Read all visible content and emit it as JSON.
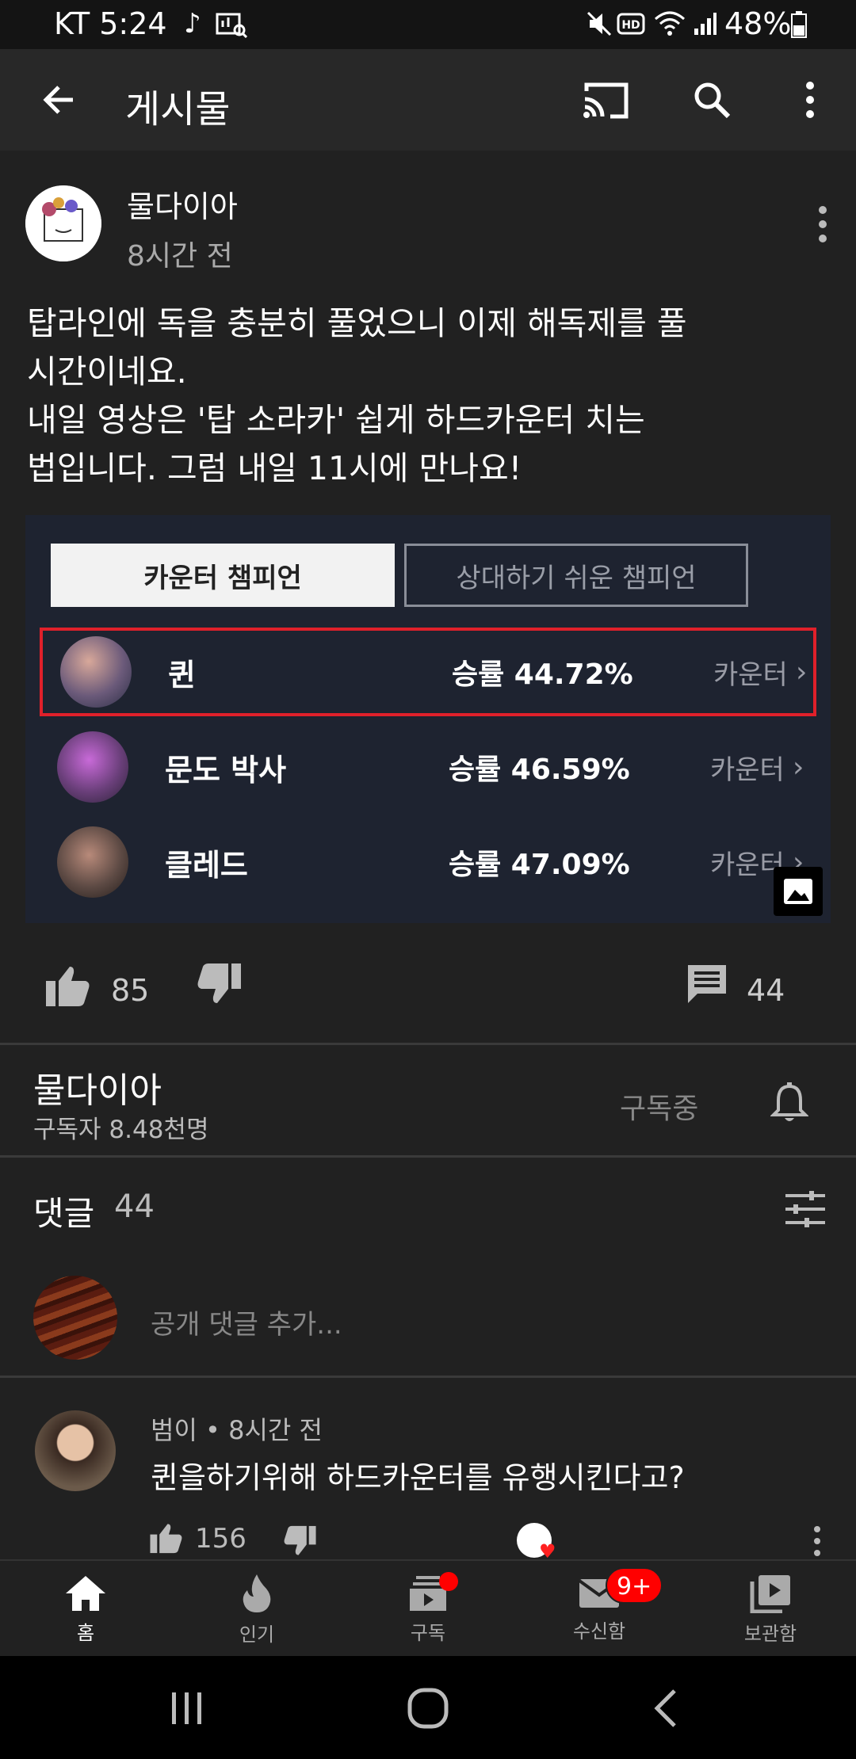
{
  "status": {
    "carrier_time": "KT 5:24",
    "battery": "48%"
  },
  "appbar": {
    "title": "게시물"
  },
  "post": {
    "author": "물다이아",
    "time": "8시간 전",
    "text": "탑라인에 독을 충분히 풀었으니 이제 해독제를 풀\n시간이네요.\n내일 영상은 '탑 소라카' 쉽게 하드카운터 치는\n법입니다. 그럼 내일 11시에 만나요!",
    "image": {
      "tab_active": "카운터 챔피언",
      "tab_inactive": "상대하기 쉬운 챔피언",
      "rows": [
        {
          "name": "퀸",
          "winrate": "승률 44.72%",
          "link": "카운터",
          "highlighted": true,
          "color": "#6b5a7a"
        },
        {
          "name": "문도 박사",
          "winrate": "승률 46.59%",
          "link": "카운터",
          "highlighted": false,
          "color": "#6a3f7a"
        },
        {
          "name": "클레드",
          "winrate": "승률 47.09%",
          "link": "카운터",
          "highlighted": false,
          "color": "#5d4a44"
        }
      ]
    },
    "likes": "85",
    "comments": "44"
  },
  "channel": {
    "name": "물다이아",
    "subscribers": "구독자 8.48천명",
    "subscribed_label": "구독중"
  },
  "comments_section": {
    "title": "댓글",
    "count": "44",
    "placeholder": "공개 댓글 추가...",
    "first_comment": {
      "author_meta": "범이 • 8시간 전",
      "text": "퀸을하기위해 하드카운터를 유행시킨다고?",
      "likes": "156"
    }
  },
  "bottom_nav": {
    "items": [
      {
        "label": "홈",
        "icon": "home-icon"
      },
      {
        "label": "인기",
        "icon": "fire-icon"
      },
      {
        "label": "구독",
        "icon": "subscriptions-icon"
      },
      {
        "label": "수신함",
        "icon": "inbox-icon"
      },
      {
        "label": "보관함",
        "icon": "library-icon"
      }
    ],
    "inbox_badge": "9+"
  },
  "colors": {
    "background": "#212121",
    "appbar": "#282828",
    "highlight_border": "#e0202a",
    "badge": "#ff0000"
  }
}
